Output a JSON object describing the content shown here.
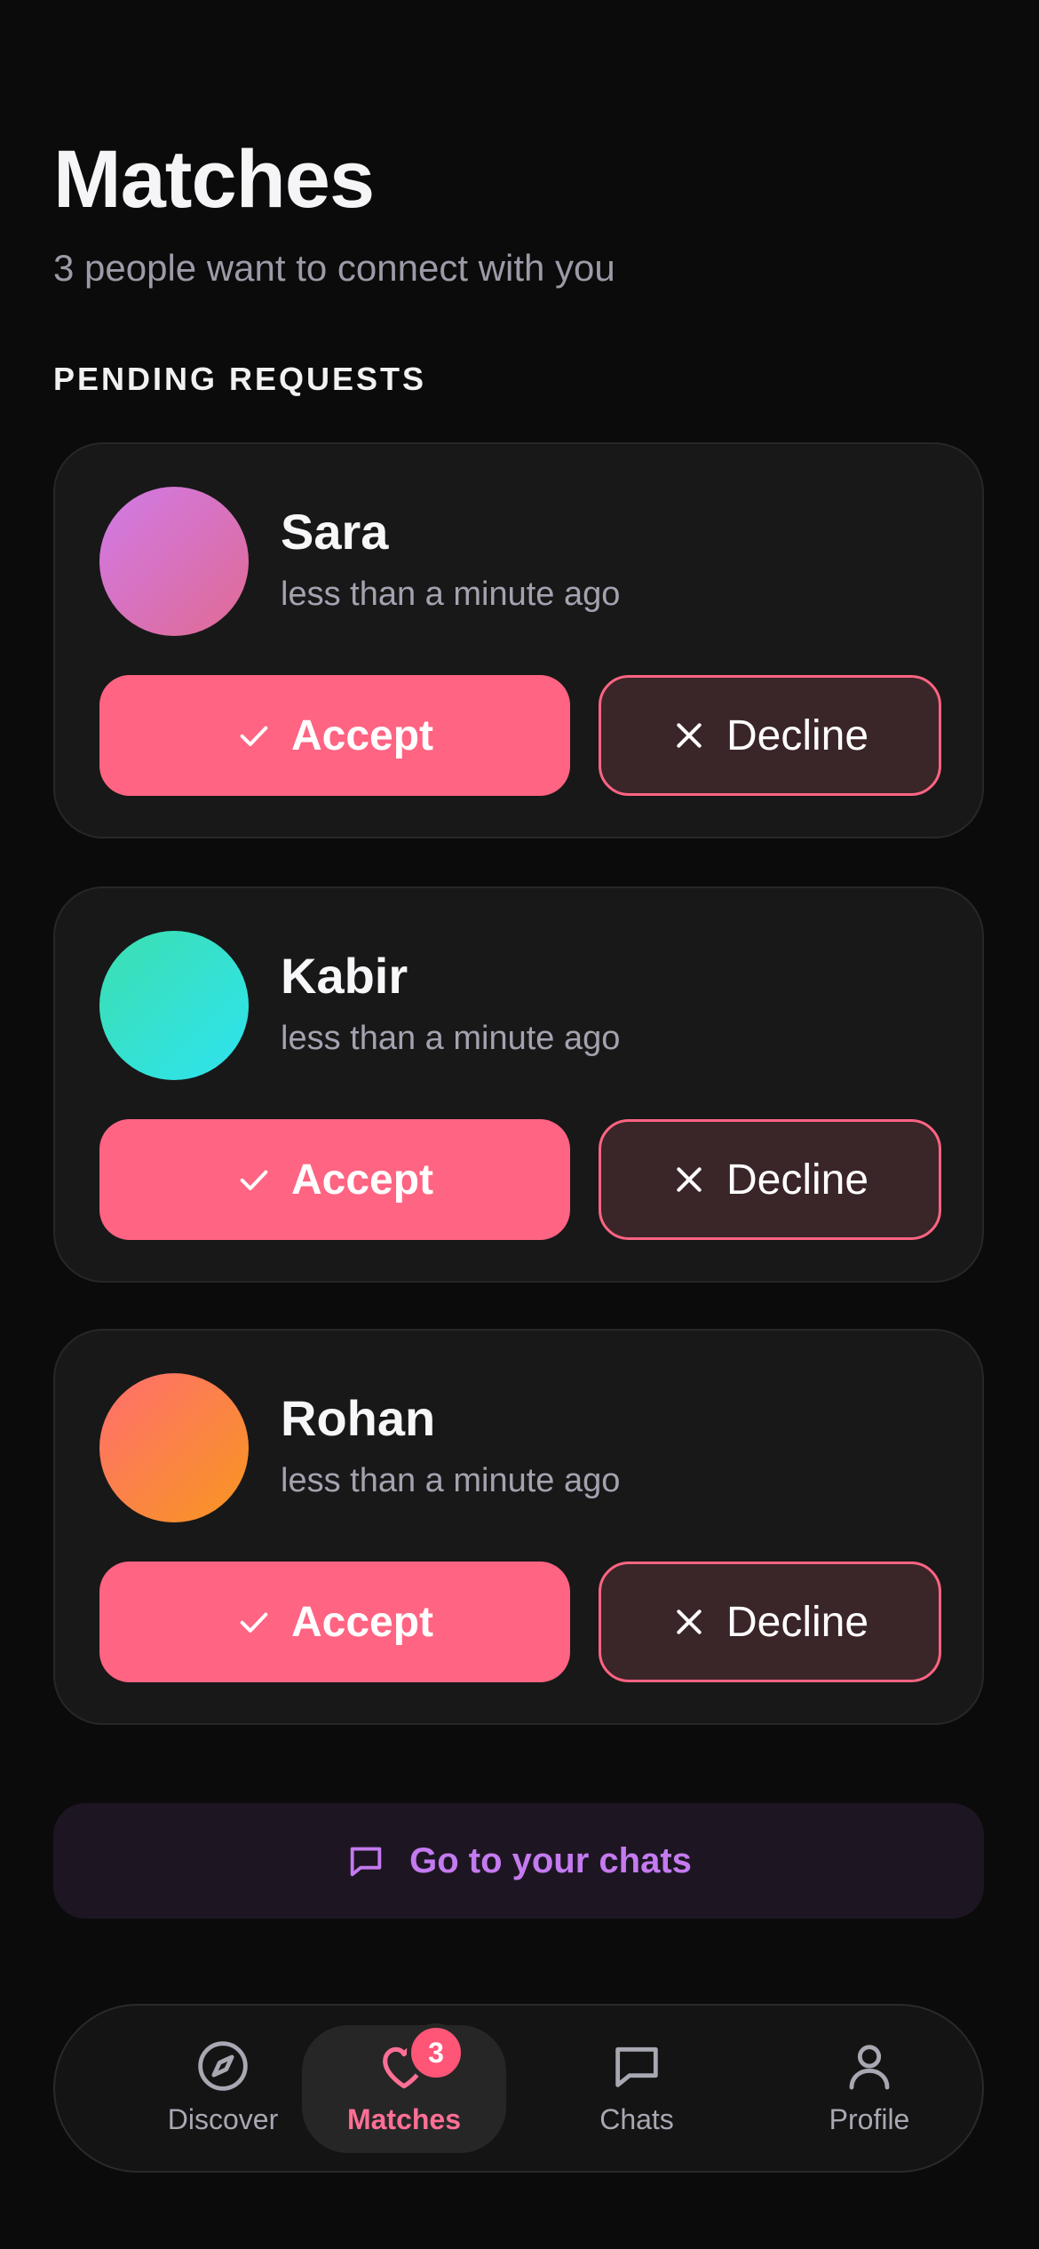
{
  "header": {
    "title": "Matches",
    "subtitle": "3 people want to connect with you"
  },
  "section": {
    "heading": "PENDING REQUESTS"
  },
  "requests": [
    {
      "name": "Sara",
      "time": "less than a minute ago",
      "accept_label": "Accept",
      "decline_label": "Decline",
      "avatar_colors": [
        "#d07ae8",
        "#e06a93"
      ]
    },
    {
      "name": "Kabir",
      "time": "less than a minute ago",
      "accept_label": "Accept",
      "decline_label": "Decline",
      "avatar_colors": [
        "#3ddfb0",
        "#2de3ef"
      ]
    },
    {
      "name": "Rohan",
      "time": "less than a minute ago",
      "accept_label": "Accept",
      "decline_label": "Decline",
      "avatar_colors": [
        "#ff6f6f",
        "#f8961f"
      ]
    }
  ],
  "chats_link": {
    "label": "Go to your chats",
    "icon": "message-square-icon"
  },
  "nav": {
    "items": [
      {
        "label": "Discover",
        "icon": "compass-icon"
      },
      {
        "label": "Matches",
        "icon": "heart-icon",
        "badge": "3"
      },
      {
        "label": "Chats",
        "icon": "message-square-icon"
      },
      {
        "label": "Profile",
        "icon": "user-icon"
      }
    ],
    "active": "Matches"
  },
  "colors": {
    "background": "#0b0b0b",
    "card": "#181818",
    "accent": "#ff6482",
    "decline_fill": "#3a2529",
    "chats_accent": "#c47af0",
    "nav_active": "#ff6f95"
  }
}
